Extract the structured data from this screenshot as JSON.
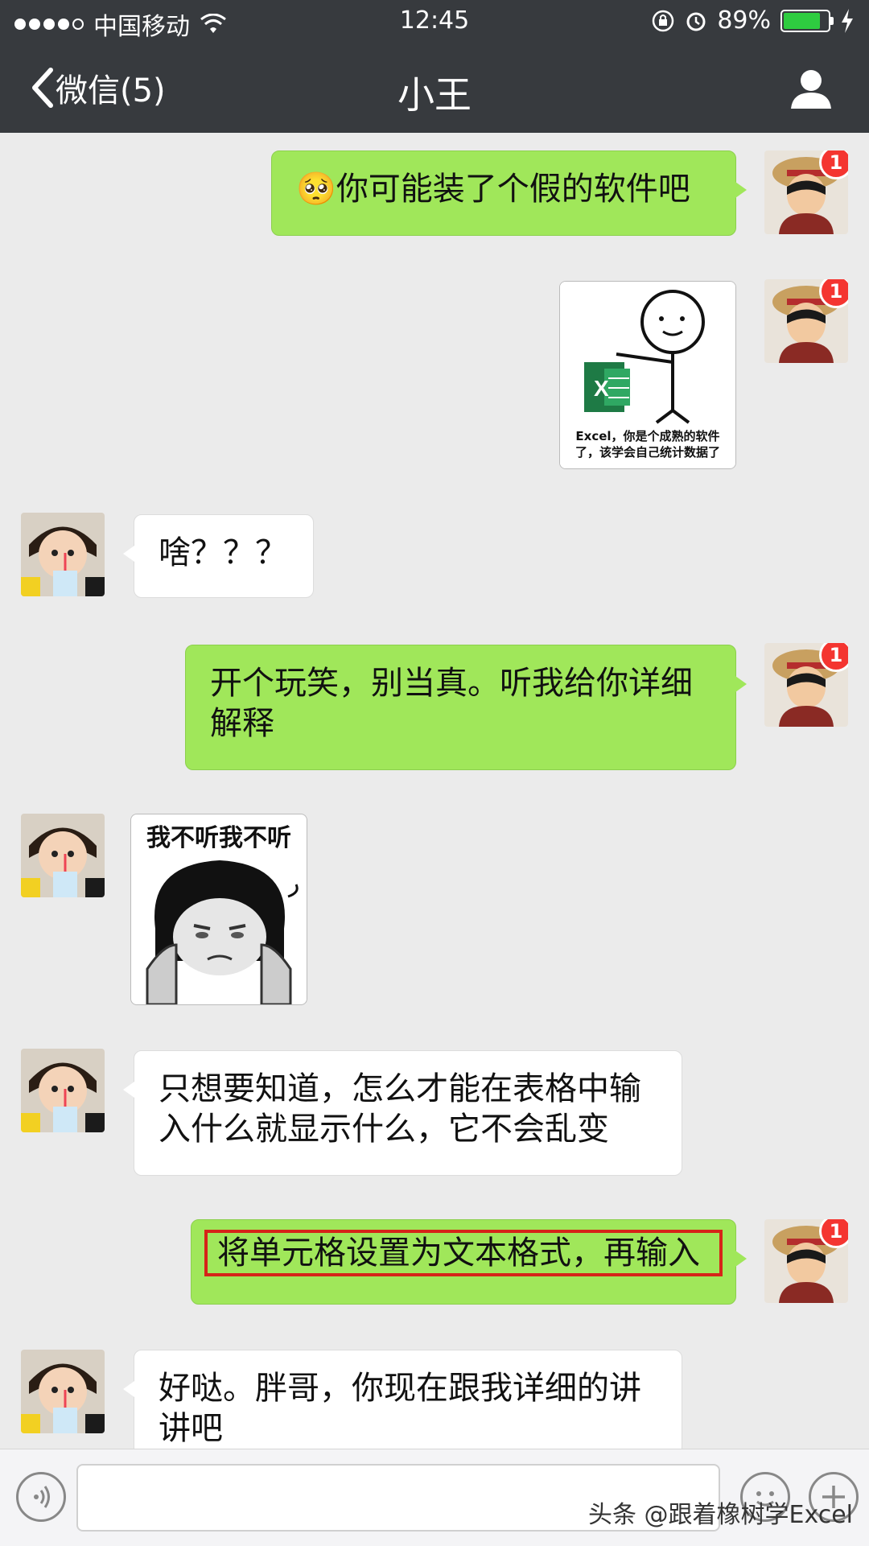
{
  "status_bar": {
    "carrier": "中国移动",
    "time": "12:45",
    "battery_text": "89%",
    "battery_level": 0.89
  },
  "nav": {
    "back_label": "微信(5)",
    "title": "小王"
  },
  "messages": [
    {
      "text": "你可能装了个假的软件吧",
      "emoji": "🥺"
    },
    {
      "sticker_text": "Excel，你是个成熟的软件了，该学会自己统计数据了"
    },
    {
      "text": "啥？？？"
    },
    {
      "text": "开个玩笑，别当真。听我给你详细解释"
    },
    {
      "sticker_text": "我不听我不听"
    },
    {
      "text": "只想要知道，怎么才能在表格中输入什么就显示什么，它不会乱变"
    },
    {
      "text": "将单元格设置为文本格式，再输入"
    },
    {
      "text": "好哒。胖哥，你现在跟我详细的讲讲吧"
    }
  ],
  "badge_count": "1",
  "watermark": "头条 @跟着橡树学Excel",
  "colors": {
    "self_bubble": "#a0e75a",
    "other_bubble": "#ffffff",
    "nav_bg": "#373a3e",
    "highlight": "#d62418",
    "badge": "#f43530"
  }
}
